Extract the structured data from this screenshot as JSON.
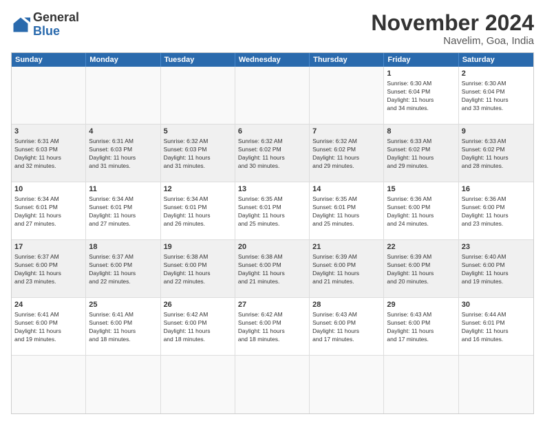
{
  "logo": {
    "general": "General",
    "blue": "Blue"
  },
  "header": {
    "title": "November 2024",
    "location": "Navelim, Goa, India"
  },
  "weekdays": [
    "Sunday",
    "Monday",
    "Tuesday",
    "Wednesday",
    "Thursday",
    "Friday",
    "Saturday"
  ],
  "rows": [
    [
      {
        "day": "",
        "info": ""
      },
      {
        "day": "",
        "info": ""
      },
      {
        "day": "",
        "info": ""
      },
      {
        "day": "",
        "info": ""
      },
      {
        "day": "",
        "info": ""
      },
      {
        "day": "1",
        "info": "Sunrise: 6:30 AM\nSunset: 6:04 PM\nDaylight: 11 hours\nand 34 minutes."
      },
      {
        "day": "2",
        "info": "Sunrise: 6:30 AM\nSunset: 6:04 PM\nDaylight: 11 hours\nand 33 minutes."
      }
    ],
    [
      {
        "day": "3",
        "info": "Sunrise: 6:31 AM\nSunset: 6:03 PM\nDaylight: 11 hours\nand 32 minutes."
      },
      {
        "day": "4",
        "info": "Sunrise: 6:31 AM\nSunset: 6:03 PM\nDaylight: 11 hours\nand 31 minutes."
      },
      {
        "day": "5",
        "info": "Sunrise: 6:32 AM\nSunset: 6:03 PM\nDaylight: 11 hours\nand 31 minutes."
      },
      {
        "day": "6",
        "info": "Sunrise: 6:32 AM\nSunset: 6:02 PM\nDaylight: 11 hours\nand 30 minutes."
      },
      {
        "day": "7",
        "info": "Sunrise: 6:32 AM\nSunset: 6:02 PM\nDaylight: 11 hours\nand 29 minutes."
      },
      {
        "day": "8",
        "info": "Sunrise: 6:33 AM\nSunset: 6:02 PM\nDaylight: 11 hours\nand 29 minutes."
      },
      {
        "day": "9",
        "info": "Sunrise: 6:33 AM\nSunset: 6:02 PM\nDaylight: 11 hours\nand 28 minutes."
      }
    ],
    [
      {
        "day": "10",
        "info": "Sunrise: 6:34 AM\nSunset: 6:01 PM\nDaylight: 11 hours\nand 27 minutes."
      },
      {
        "day": "11",
        "info": "Sunrise: 6:34 AM\nSunset: 6:01 PM\nDaylight: 11 hours\nand 27 minutes."
      },
      {
        "day": "12",
        "info": "Sunrise: 6:34 AM\nSunset: 6:01 PM\nDaylight: 11 hours\nand 26 minutes."
      },
      {
        "day": "13",
        "info": "Sunrise: 6:35 AM\nSunset: 6:01 PM\nDaylight: 11 hours\nand 25 minutes."
      },
      {
        "day": "14",
        "info": "Sunrise: 6:35 AM\nSunset: 6:01 PM\nDaylight: 11 hours\nand 25 minutes."
      },
      {
        "day": "15",
        "info": "Sunrise: 6:36 AM\nSunset: 6:00 PM\nDaylight: 11 hours\nand 24 minutes."
      },
      {
        "day": "16",
        "info": "Sunrise: 6:36 AM\nSunset: 6:00 PM\nDaylight: 11 hours\nand 23 minutes."
      }
    ],
    [
      {
        "day": "17",
        "info": "Sunrise: 6:37 AM\nSunset: 6:00 PM\nDaylight: 11 hours\nand 23 minutes."
      },
      {
        "day": "18",
        "info": "Sunrise: 6:37 AM\nSunset: 6:00 PM\nDaylight: 11 hours\nand 22 minutes."
      },
      {
        "day": "19",
        "info": "Sunrise: 6:38 AM\nSunset: 6:00 PM\nDaylight: 11 hours\nand 22 minutes."
      },
      {
        "day": "20",
        "info": "Sunrise: 6:38 AM\nSunset: 6:00 PM\nDaylight: 11 hours\nand 21 minutes."
      },
      {
        "day": "21",
        "info": "Sunrise: 6:39 AM\nSunset: 6:00 PM\nDaylight: 11 hours\nand 21 minutes."
      },
      {
        "day": "22",
        "info": "Sunrise: 6:39 AM\nSunset: 6:00 PM\nDaylight: 11 hours\nand 20 minutes."
      },
      {
        "day": "23",
        "info": "Sunrise: 6:40 AM\nSunset: 6:00 PM\nDaylight: 11 hours\nand 19 minutes."
      }
    ],
    [
      {
        "day": "24",
        "info": "Sunrise: 6:41 AM\nSunset: 6:00 PM\nDaylight: 11 hours\nand 19 minutes."
      },
      {
        "day": "25",
        "info": "Sunrise: 6:41 AM\nSunset: 6:00 PM\nDaylight: 11 hours\nand 18 minutes."
      },
      {
        "day": "26",
        "info": "Sunrise: 6:42 AM\nSunset: 6:00 PM\nDaylight: 11 hours\nand 18 minutes."
      },
      {
        "day": "27",
        "info": "Sunrise: 6:42 AM\nSunset: 6:00 PM\nDaylight: 11 hours\nand 18 minutes."
      },
      {
        "day": "28",
        "info": "Sunrise: 6:43 AM\nSunset: 6:00 PM\nDaylight: 11 hours\nand 17 minutes."
      },
      {
        "day": "29",
        "info": "Sunrise: 6:43 AM\nSunset: 6:00 PM\nDaylight: 11 hours\nand 17 minutes."
      },
      {
        "day": "30",
        "info": "Sunrise: 6:44 AM\nSunset: 6:01 PM\nDaylight: 11 hours\nand 16 minutes."
      }
    ],
    [
      {
        "day": "",
        "info": ""
      },
      {
        "day": "",
        "info": ""
      },
      {
        "day": "",
        "info": ""
      },
      {
        "day": "",
        "info": ""
      },
      {
        "day": "",
        "info": ""
      },
      {
        "day": "",
        "info": ""
      },
      {
        "day": "",
        "info": ""
      }
    ]
  ]
}
